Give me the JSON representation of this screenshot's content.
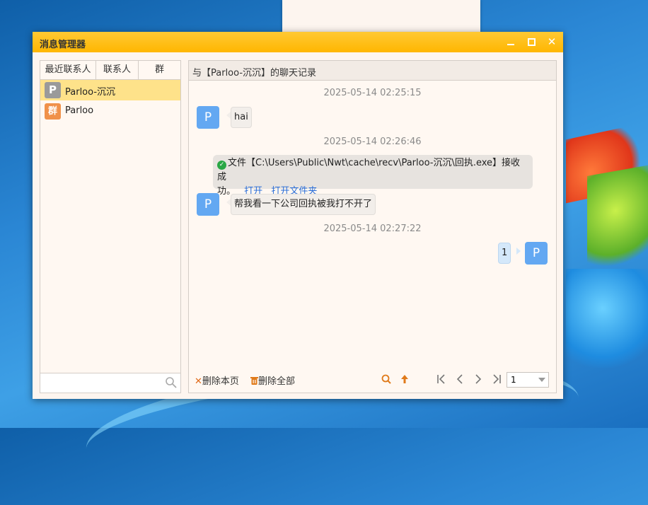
{
  "window": {
    "title": "消息管理器"
  },
  "tabs": [
    "最近联系人",
    "联系人",
    "群"
  ],
  "contacts": [
    {
      "initial": "P",
      "name": "Parloo-沉沉",
      "color": "#9a9a9a",
      "selected": true
    },
    {
      "initial": "群",
      "name": "Parloo",
      "color": "#f0914a",
      "selected": false
    }
  ],
  "search": {
    "placeholder": ""
  },
  "chat": {
    "title": "与【Parloo-沉沉】的聊天记录",
    "timestamps": [
      "2025-05-14 02:25:15",
      "2025-05-14 02:26:46",
      "2025-05-14 02:27:22"
    ],
    "messages": {
      "m1": {
        "avatar": "P",
        "text": "hai"
      },
      "file": {
        "line1": "文件【C:\\Users\\Public\\Nwt\\cache\\recv\\Parloo-沉沉\\回执.exe】接收成",
        "line2": "功。",
        "open": "打开",
        "open_folder": "打开文件夹"
      },
      "m2": {
        "avatar": "P",
        "text": "帮我看一下公司回执被我打不开了"
      },
      "m3": {
        "avatar": "P",
        "text": "1"
      }
    }
  },
  "toolbar": {
    "delete_page": "删除本页",
    "delete_all": "删除全部",
    "page_value": "1"
  },
  "colors": {
    "titlebar": "#ffb600",
    "selected_contact": "#fee28a",
    "avatar_blue": "#63a8f2",
    "link": "#2a6ed8"
  }
}
